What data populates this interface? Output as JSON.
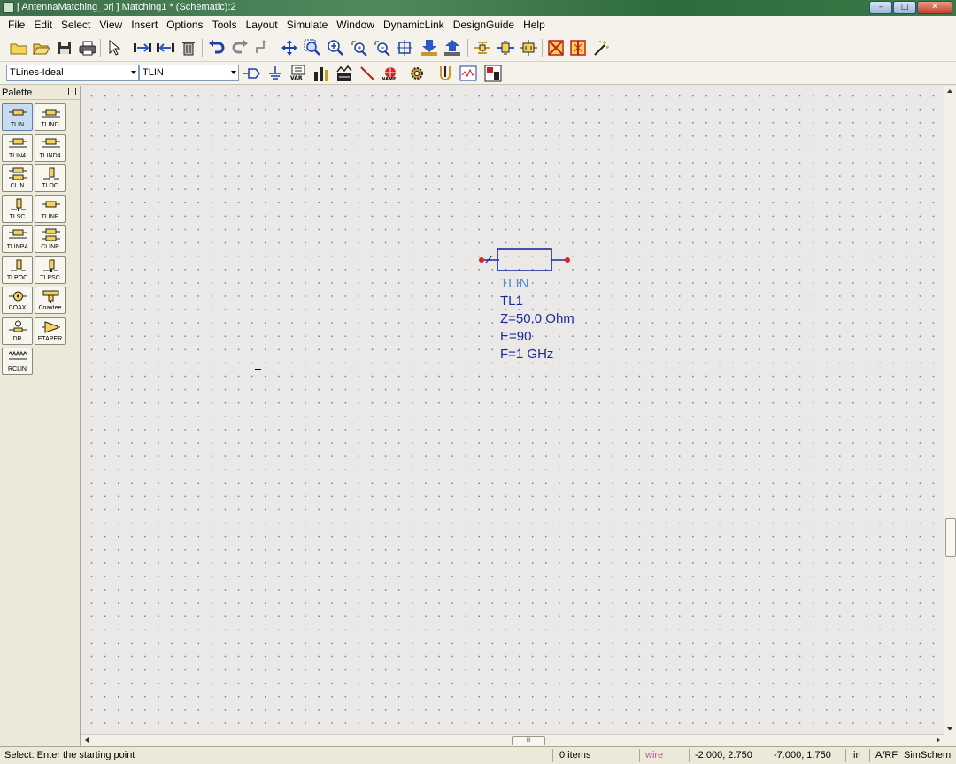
{
  "window": {
    "title": "[ AntennaMatching_prj ] Matching1 * (Schematic):2",
    "controls": {
      "minimize": "–",
      "maximize": "□",
      "close": "✕"
    }
  },
  "menu": [
    "File",
    "Edit",
    "Select",
    "View",
    "Insert",
    "Options",
    "Tools",
    "Layout",
    "Simulate",
    "Window",
    "DynamicLink",
    "DesignGuide",
    "Help"
  ],
  "toolbar2": {
    "library_select": "TLines-Ideal",
    "component_select": "TLIN",
    "var_label": "VAR",
    "name_label": "NAME"
  },
  "palette": {
    "title": "Palette",
    "items": [
      "TLIN",
      "TLIND",
      "TLIN4",
      "TLIND4",
      "CLIN",
      "TLOC",
      "TLSC",
      "TLINP",
      "TLINP4",
      "CLINP",
      "TLPOC",
      "TLPSC",
      "COAX",
      "Coaxtee",
      "DR",
      "ETAPER",
      "RCLIN"
    ],
    "selected": "TLIN"
  },
  "component": {
    "type_label": "TLIN",
    "instance": "TL1",
    "z": "Z=50.0 Ohm",
    "e": "E=90",
    "f": "F=1 GHz"
  },
  "hscroll_thumb": "III",
  "status": {
    "prompt": "Select: Enter the starting point",
    "items": "0 items",
    "mode": "wire",
    "coord1": "-2.000, 2.750",
    "coord2": "-7.000, 1.750",
    "unit": "in",
    "rf": "A/RF",
    "sim": "SimSchem"
  },
  "colors": {
    "canvas": "#ebe8e8",
    "wire_component": "#1a2a9c",
    "component_type": "#4f8fd3",
    "pin": "#e02020",
    "status_wire": "#c848a8"
  }
}
